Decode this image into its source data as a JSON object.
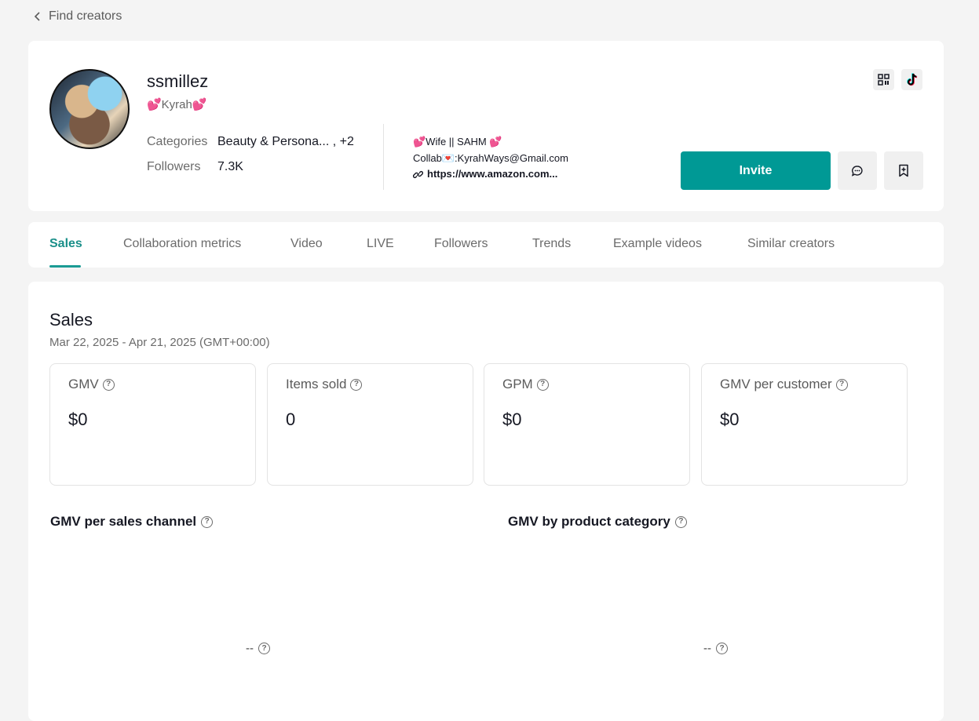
{
  "nav": {
    "back_label": "Find creators"
  },
  "profile": {
    "username": "ssmillez",
    "nickname": "💕Kyrah💕",
    "categories_label": "Categories",
    "categories_value": "Beauty & Persona... , +2",
    "followers_label": "Followers",
    "followers_value": "7.3K",
    "bio_line1": "💕Wife || SAHM 💕",
    "bio_line2": "Collab💌:KyrahWays@Gmail.com",
    "bio_link": "https://www.amazon.com...",
    "invite_label": "Invite"
  },
  "tabs": [
    {
      "label": "Sales"
    },
    {
      "label": "Collaboration metrics"
    },
    {
      "label": "Video"
    },
    {
      "label": "LIVE"
    },
    {
      "label": "Followers"
    },
    {
      "label": "Trends"
    },
    {
      "label": "Example videos"
    },
    {
      "label": "Similar creators"
    }
  ],
  "sales": {
    "title": "Sales",
    "date_range": "Mar 22, 2025 - Apr 21, 2025 (GMT+00:00)",
    "metrics": [
      {
        "label": "GMV",
        "value": "$0"
      },
      {
        "label": "Items sold",
        "value": "0"
      },
      {
        "label": "GPM",
        "value": "$0"
      },
      {
        "label": "GMV per customer",
        "value": "$0"
      }
    ],
    "channel_title": "GMV per sales channel",
    "category_title": "GMV by product category",
    "channel_empty": "--",
    "category_empty": "--"
  },
  "colors": {
    "accent": "#009995",
    "active_tab": "#1a8f89"
  }
}
